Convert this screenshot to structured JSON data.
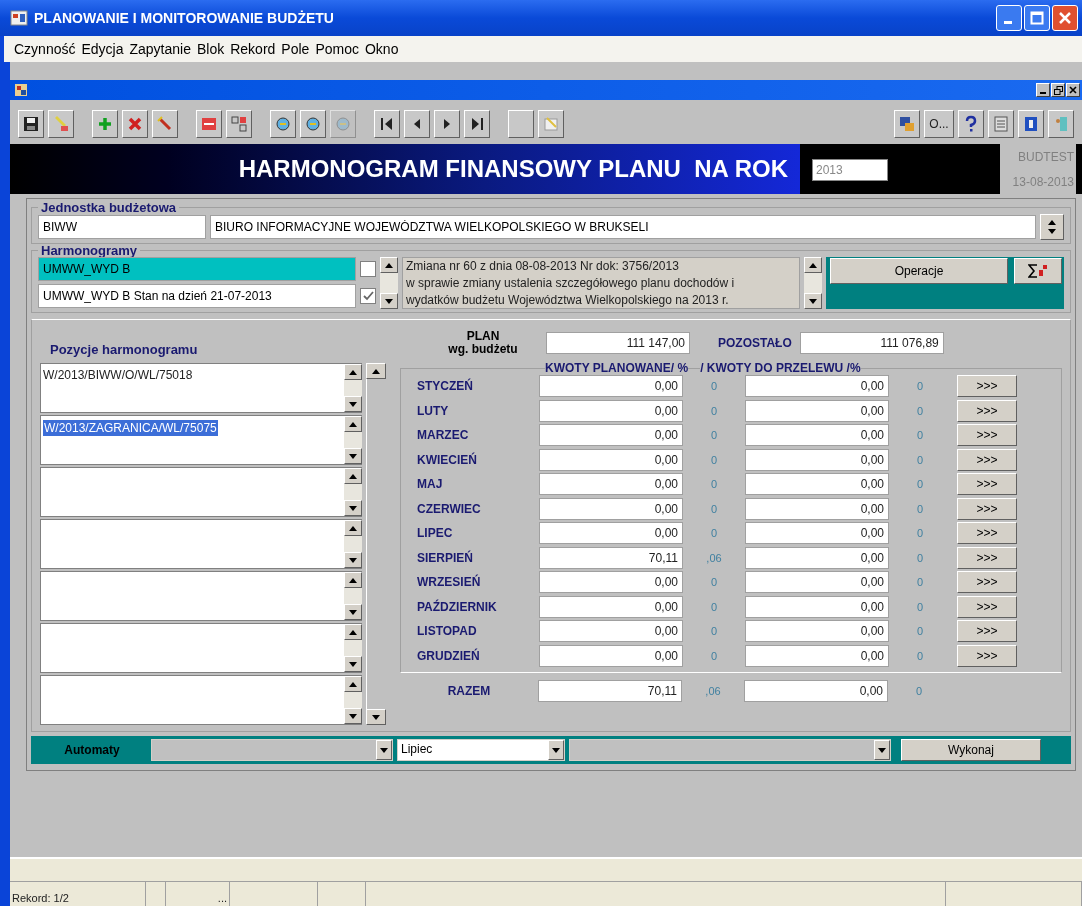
{
  "window": {
    "title": "PLANOWANIE I MONITOROWANIE BUDŻETU"
  },
  "menu": [
    "Czynność",
    "Edycja",
    "Zapytanie",
    "Blok",
    "Rekord",
    "Pole",
    "Pomoc",
    "Okno"
  ],
  "toolbar": {
    "left": [
      {
        "disabled": false
      },
      {
        "disabled": false
      },
      {
        "disabled": false
      },
      {
        "disabled": false
      },
      {
        "disabled": false
      },
      {
        "disabled": false
      },
      {
        "disabled": false
      },
      {
        "disabled": false
      },
      {
        "disabled": false
      },
      {
        "disabled": true
      },
      {
        "disabled": false
      },
      {
        "disabled": false
      },
      {
        "disabled": false
      },
      {
        "disabled": false
      },
      {
        "disabled": false
      },
      {
        "disabled": false
      }
    ],
    "right_label": "O..."
  },
  "header": {
    "title": "HARMONOGRAM FINANSOWY PLANU  NA ROK",
    "year": "2013",
    "user": "BUDTEST",
    "date": "13-08-2013"
  },
  "jednostka": {
    "label": "Jednostka budżetowa",
    "code": "BIWW",
    "name": "BIURO INFORMACYJNE WOJEWÓDZTWA WIELKOPOLSKIEGO W BRUKSELI"
  },
  "harmonogramy": {
    "label": "Harmonogramy",
    "rows": [
      {
        "name": "UMWW_WYD B",
        "selected": true,
        "checked": false
      },
      {
        "name": "UMWW_WYD B Stan na dzień 21-07-2013",
        "selected": false,
        "checked": true
      }
    ],
    "description": [
      "Zmiana nr 60 z dnia 08-08-2013 Nr dok: 3756/2013",
      "w sprawie zmiany ustalenia szczegółowego planu dochodów i",
      "wydatków budżetu Województwa Wielkopolskiego na 2013 r."
    ],
    "operations_button": "Operacje"
  },
  "pozycje": {
    "label": "Pozycje harmonogramu",
    "items": [
      {
        "value": "W/2013/BIWW/O/WL/75018",
        "selected": false
      },
      {
        "value": "W/2013/ZAGRANICA/WL/75075",
        "selected": true
      }
    ]
  },
  "plan": {
    "label_1": "PLAN",
    "label_2": "wg. budżetu",
    "value": "111 147,00",
    "remaining_label": "POZOSTAŁO",
    "remaining": "111 076,89"
  },
  "months": {
    "col_planned": "KWOTY PLANOWANE/ %",
    "col_transfer": "/ KWOTY DO PRZELEWU /%",
    "rows": [
      {
        "name": "STYCZEŃ",
        "planned": "0,00",
        "planned_pct": "0",
        "transfer": "0,00",
        "transfer_pct": "0",
        "button": ">>>"
      },
      {
        "name": "LUTY",
        "planned": "0,00",
        "planned_pct": "0",
        "transfer": "0,00",
        "transfer_pct": "0",
        "button": ">>>"
      },
      {
        "name": "MARZEC",
        "planned": "0,00",
        "planned_pct": "0",
        "transfer": "0,00",
        "transfer_pct": "0",
        "button": ">>>"
      },
      {
        "name": "KWIECIEŃ",
        "planned": "0,00",
        "planned_pct": "0",
        "transfer": "0,00",
        "transfer_pct": "0",
        "button": ">>>"
      },
      {
        "name": "MAJ",
        "planned": "0,00",
        "planned_pct": "0",
        "transfer": "0,00",
        "transfer_pct": "0",
        "button": ">>>"
      },
      {
        "name": "CZERWIEC",
        "planned": "0,00",
        "planned_pct": "0",
        "transfer": "0,00",
        "transfer_pct": "0",
        "button": ">>>"
      },
      {
        "name": "LIPEC",
        "planned": "0,00",
        "planned_pct": "0",
        "transfer": "0,00",
        "transfer_pct": "0",
        "button": ">>>"
      },
      {
        "name": "SIERPIEŃ",
        "planned": "70,11",
        "planned_pct": ",06",
        "transfer": "0,00",
        "transfer_pct": "0",
        "button": ">>>"
      },
      {
        "name": "WRZESIEŃ",
        "planned": "0,00",
        "planned_pct": "0",
        "transfer": "0,00",
        "transfer_pct": "0",
        "button": ">>>"
      },
      {
        "name": "PAŹDZIERNIK",
        "planned": "0,00",
        "planned_pct": "0",
        "transfer": "0,00",
        "transfer_pct": "0",
        "button": ">>>"
      },
      {
        "name": "LISTOPAD",
        "planned": "0,00",
        "planned_pct": "0",
        "transfer": "0,00",
        "transfer_pct": "0",
        "button": ">>>"
      },
      {
        "name": "GRUDZIEŃ",
        "planned": "0,00",
        "planned_pct": "0",
        "transfer": "0,00",
        "transfer_pct": "0",
        "button": ">>>"
      }
    ],
    "total": {
      "name": "RAZEM",
      "planned": "70,11",
      "planned_pct": ",06",
      "transfer": "0,00",
      "transfer_pct": "0"
    }
  },
  "automaty": {
    "label": "Automaty",
    "month": "Lipiec",
    "button": "Wykonaj"
  },
  "status_bar": {
    "record": "Rekord: 1/2",
    "field_3": "..."
  }
}
